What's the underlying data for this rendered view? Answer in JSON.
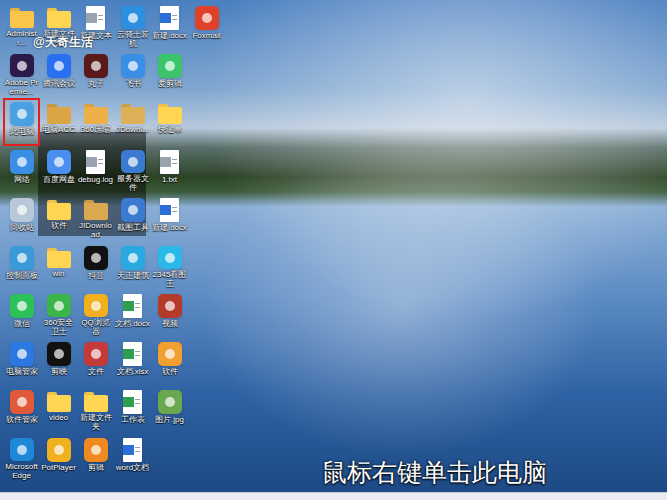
{
  "watermark": "@天奇生活",
  "caption": "鼠标右键单击此电脑",
  "desktop": {
    "rows": [
      [
        {
          "label": "Administr...",
          "kind": "folder",
          "color": "#e3b341",
          "selected": false
        },
        {
          "label": "新建文件夹",
          "kind": "folder",
          "color": "#f0c24b",
          "selected": false
        },
        {
          "label": "新建文本",
          "kind": "doc",
          "color": "#9aa4b0",
          "selected": false
        },
        {
          "label": "云骑士装机",
          "kind": "app",
          "color": "#2d8fe0",
          "selected": false
        },
        {
          "label": "新建.docx",
          "kind": "doc",
          "color": "#2b6fd6",
          "selected": false
        },
        {
          "label": "Foxmail",
          "kind": "app",
          "color": "#e0412b",
          "selected": false
        }
      ],
      [
        {
          "label": "Adobe Premie...",
          "kind": "app",
          "color": "#2b1a4a",
          "selected": false
        },
        {
          "label": "腾讯会议",
          "kind": "app",
          "color": "#2a6ff0",
          "selected": false
        },
        {
          "label": "丸子",
          "kind": "app",
          "color": "#5a1a1a",
          "selected": false
        },
        {
          "label": "飞书",
          "kind": "app",
          "color": "#3a8ee6",
          "selected": false
        },
        {
          "label": "爱剪辑",
          "kind": "app",
          "color": "#3cc46a",
          "selected": false
        }
      ],
      [
        {
          "label": "此电脑",
          "kind": "app",
          "color": "#4aa0e0",
          "selected": true
        },
        {
          "label": "电脑ACC",
          "kind": "folder",
          "color": "#c8963e",
          "selected": false
        },
        {
          "label": "360压缩",
          "kind": "folder",
          "color": "#d8a040",
          "selected": false
        },
        {
          "label": "JDownl...",
          "kind": "folder",
          "color": "#caa050",
          "selected": false
        },
        {
          "label": "快递单",
          "kind": "folder",
          "color": "#f0c24b",
          "selected": false
        }
      ],
      [
        {
          "label": "网络",
          "kind": "app",
          "color": "#3a8ee6",
          "selected": false
        },
        {
          "label": "百度网盘",
          "kind": "app",
          "color": "#4a8ef0",
          "selected": false
        },
        {
          "label": "debug.log",
          "kind": "doc",
          "color": "#9aa4b0",
          "selected": false
        },
        {
          "label": "服务器文件",
          "kind": "app",
          "color": "#3a7ad0",
          "selected": false
        },
        {
          "label": "1.txt",
          "kind": "doc",
          "color": "#9aa4b0",
          "selected": false
        }
      ],
      [
        {
          "label": "回收站",
          "kind": "app",
          "color": "#b8c8d8",
          "selected": false
        },
        {
          "label": "软件",
          "kind": "folder",
          "color": "#f0c24b",
          "selected": false
        },
        {
          "label": "JIDownload",
          "kind": "folder",
          "color": "#c89a4a",
          "selected": false
        },
        {
          "label": "截图工具",
          "kind": "app",
          "color": "#3a7ad0",
          "selected": false
        },
        {
          "label": "新建.docx",
          "kind": "doc",
          "color": "#2b6fd6",
          "selected": false
        }
      ],
      [
        {
          "label": "控制面板",
          "kind": "app",
          "color": "#3a9ad8",
          "selected": false
        },
        {
          "label": "win",
          "kind": "folder",
          "color": "#f0c24b",
          "selected": false
        },
        {
          "label": "抖音",
          "kind": "app",
          "color": "#111111",
          "selected": false
        },
        {
          "label": "天正建筑",
          "kind": "app",
          "color": "#2aa8e0",
          "selected": false
        },
        {
          "label": "2345看图王",
          "kind": "app",
          "color": "#2ab8e8",
          "selected": false
        }
      ],
      [
        {
          "label": "微信",
          "kind": "app",
          "color": "#2dc15a",
          "selected": false
        },
        {
          "label": "360安全卫士",
          "kind": "app",
          "color": "#3bb54a",
          "selected": false
        },
        {
          "label": "QQ浏览器",
          "kind": "app",
          "color": "#f2b01e",
          "selected": false
        },
        {
          "label": "文档.docx",
          "kind": "doc",
          "color": "#2e9e4f",
          "selected": false
        },
        {
          "label": "视频",
          "kind": "app",
          "color": "#b43a2a",
          "selected": false
        }
      ],
      [
        {
          "label": "电脑管家",
          "kind": "app",
          "color": "#2a78e0",
          "selected": false
        },
        {
          "label": "剪映",
          "kind": "app",
          "color": "#111111",
          "selected": false
        },
        {
          "label": "文件",
          "kind": "app",
          "color": "#c43a3a",
          "selected": false
        },
        {
          "label": "文档.xlsx",
          "kind": "doc",
          "color": "#2e9e4f",
          "selected": false
        },
        {
          "label": "软件",
          "kind": "app",
          "color": "#f0a030",
          "selected": false
        }
      ],
      [
        {
          "label": "软件管家",
          "kind": "app",
          "color": "#e05a3a",
          "selected": false
        },
        {
          "label": "video",
          "kind": "folder",
          "color": "#f0c24b",
          "selected": false
        },
        {
          "label": "新建文件夹",
          "kind": "folder",
          "color": "#f0c24b",
          "selected": false
        },
        {
          "label": "工作表",
          "kind": "doc",
          "color": "#2e9e4f",
          "selected": false
        },
        {
          "label": "图片.jpg",
          "kind": "app",
          "color": "#6aa84f",
          "selected": false
        }
      ],
      [
        {
          "label": "Microsoft Edge",
          "kind": "app",
          "color": "#1e88d8",
          "selected": false
        },
        {
          "label": "PotPlayer",
          "kind": "app",
          "color": "#f0b020",
          "selected": false
        },
        {
          "label": "剪辑",
          "kind": "app",
          "color": "#f08a20",
          "selected": false
        },
        {
          "label": "word文档",
          "kind": "doc",
          "color": "#2b6fd6",
          "selected": false
        }
      ]
    ]
  }
}
